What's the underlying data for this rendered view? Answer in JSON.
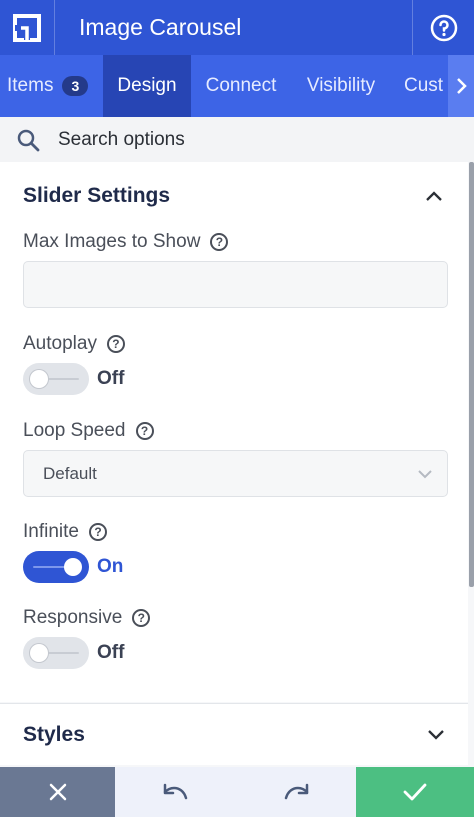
{
  "header": {
    "title": "Image Carousel",
    "logo_icon": "app-logo-icon",
    "help_icon": "help-circle-icon"
  },
  "tabs": [
    {
      "label": "Items",
      "badge": "3",
      "active": false
    },
    {
      "label": "Design",
      "active": true
    },
    {
      "label": "Connect",
      "active": false
    },
    {
      "label": "Visibility",
      "active": false
    },
    {
      "label": "Cust",
      "active": false
    }
  ],
  "search": {
    "placeholder": "Search options",
    "value": ""
  },
  "slider_settings": {
    "title": "Slider Settings",
    "expanded": true,
    "max_images": {
      "label": "Max Images to Show",
      "value": ""
    },
    "autoplay": {
      "label": "Autoplay",
      "state": "Off"
    },
    "loop_speed": {
      "label": "Loop Speed",
      "value": "Default"
    },
    "infinite": {
      "label": "Infinite",
      "state": "On"
    },
    "responsive": {
      "label": "Responsive",
      "state": "Off"
    }
  },
  "styles_section": {
    "title": "Styles",
    "expanded": false
  },
  "footer": {
    "close_icon": "close-icon",
    "undo_icon": "undo-icon",
    "redo_icon": "redo-icon",
    "confirm_icon": "checkmark-icon"
  },
  "colors": {
    "header": "#2f55d4",
    "tabs": "#3d64e6",
    "active_tab": "#2745b4",
    "toggle_on": "#2f55d4",
    "close_button": "#6a7893",
    "confirm_button": "#4cbf82"
  }
}
